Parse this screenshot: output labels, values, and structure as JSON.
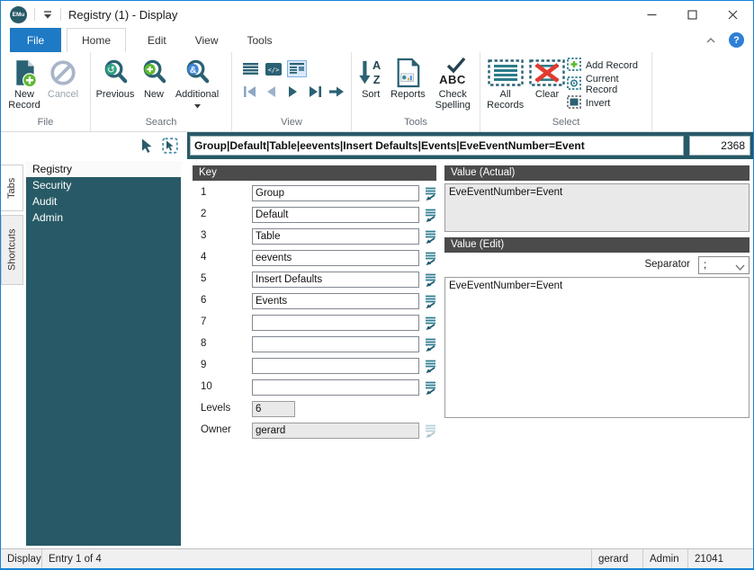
{
  "titlebar": {
    "logo_text": "EMu",
    "title": "Registry (1) - Display"
  },
  "ribbon_tabs": {
    "file": "File",
    "home": "Home",
    "edit": "Edit",
    "view": "View",
    "tools": "Tools"
  },
  "ribbon": {
    "file_group": {
      "label": "File",
      "new_record": "New Record",
      "cancel": "Cancel"
    },
    "search_group": {
      "label": "Search",
      "previous": "Previous",
      "new": "New",
      "additional": "Additional"
    },
    "view_group": {
      "label": "View"
    },
    "tools_group": {
      "label": "Tools",
      "sort": "Sort",
      "reports": "Reports",
      "check_spelling": "Check Spelling",
      "abc": "ABC"
    },
    "select_group": {
      "label": "Select",
      "all_records": "All Records",
      "clear": "Clear",
      "add_record": "Add Record",
      "current_record": "Current Record",
      "invert": "Invert"
    }
  },
  "pathbar": {
    "path": "Group|Default|Table|eevents|Insert Defaults|Events|EveEventNumber=Event",
    "count": "2368"
  },
  "sidebar": {
    "tabs": [
      {
        "label": "Tabs"
      },
      {
        "label": "Shortcuts"
      }
    ],
    "items": [
      {
        "label": "Registry"
      },
      {
        "label": "Security"
      },
      {
        "label": "Audit"
      },
      {
        "label": "Admin"
      }
    ]
  },
  "key_panel": {
    "title": "Key",
    "rows": [
      {
        "num": "1",
        "value": "Group"
      },
      {
        "num": "2",
        "value": "Default"
      },
      {
        "num": "3",
        "value": "Table"
      },
      {
        "num": "4",
        "value": "eevents"
      },
      {
        "num": "5",
        "value": "Insert Defaults"
      },
      {
        "num": "6",
        "value": "Events"
      },
      {
        "num": "7",
        "value": ""
      },
      {
        "num": "8",
        "value": ""
      },
      {
        "num": "9",
        "value": ""
      },
      {
        "num": "10",
        "value": ""
      }
    ],
    "levels_label": "Levels",
    "levels_value": "6",
    "owner_label": "Owner",
    "owner_value": "gerard"
  },
  "value_actual": {
    "title": "Value (Actual)",
    "content": "EveEventNumber=Event"
  },
  "value_edit": {
    "title": "Value (Edit)",
    "separator_label": "Separator",
    "separator_value": ";",
    "content": "EveEventNumber=Event"
  },
  "statusbar": {
    "mode": "Display",
    "entry": "Entry 1 of 4",
    "user": "gerard",
    "role": "Admin",
    "number": "21041"
  },
  "colors": {
    "accent_teal": "#275a66",
    "icon_teal": "#2a6173",
    "file_tab_blue": "#1e7ac5",
    "header_gray": "#4b4b4b",
    "window_border": "#1883d7",
    "green": "#5cb82e",
    "red": "#e23b2e",
    "blue_badge": "#4186d8"
  }
}
